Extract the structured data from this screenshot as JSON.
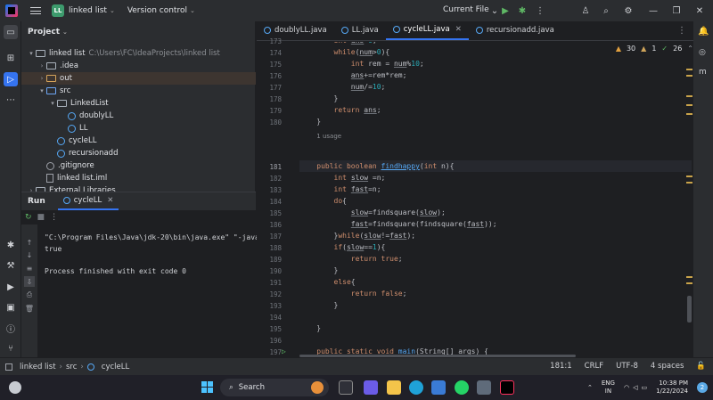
{
  "titlebar": {
    "project_badge": "LL",
    "project_name": "linked list",
    "vcs_label": "Version control",
    "run_config": "Current File"
  },
  "project_panel": {
    "title": "Project",
    "tree": [
      {
        "label": "linked list",
        "path": "C:\\Users\\FC\\IdeaProjects\\linked list",
        "indent": 0,
        "arrow": "▾",
        "icon": "folder"
      },
      {
        "label": ".idea",
        "indent": 1,
        "arrow": "›",
        "icon": "folder"
      },
      {
        "label": "out",
        "indent": 1,
        "arrow": "›",
        "icon": "folder-orange"
      },
      {
        "label": "src",
        "indent": 1,
        "arrow": "▾",
        "icon": "folder-blue"
      },
      {
        "label": "LinkedList",
        "indent": 2,
        "arrow": "▾",
        "icon": "folder"
      },
      {
        "label": "doublyLL",
        "indent": 3,
        "arrow": "",
        "icon": "class"
      },
      {
        "label": "LL",
        "indent": 3,
        "arrow": "",
        "icon": "class"
      },
      {
        "label": "cycleLL",
        "indent": 2,
        "arrow": "",
        "icon": "class"
      },
      {
        "label": "recursionadd",
        "indent": 2,
        "arrow": "",
        "icon": "class"
      },
      {
        "label": ".gitignore",
        "indent": 1,
        "arrow": "",
        "icon": "git"
      },
      {
        "label": "linked list.iml",
        "indent": 1,
        "arrow": "",
        "icon": "file"
      },
      {
        "label": "External Libraries",
        "indent": 0,
        "arrow": "›",
        "icon": "folder"
      }
    ]
  },
  "run_panel": {
    "title": "Run",
    "tab_label": "cycleLL",
    "console_lines": [
      "\"C:\\Program Files\\Java\\jdk-20\\bin\\java.exe\" \"-javaa",
      "true",
      "",
      "Process finished with exit code 0"
    ]
  },
  "editor": {
    "tabs": [
      {
        "label": "doublyLL.java",
        "active": false
      },
      {
        "label": "LL.java",
        "active": false
      },
      {
        "label": "cycleLL.java",
        "active": true
      },
      {
        "label": "recursionadd.java",
        "active": false
      }
    ],
    "inspections": {
      "warnings": "30",
      "weak": "1",
      "ok": "26"
    },
    "line_numbers": [
      "173",
      "174",
      "175",
      "176",
      "177",
      "178",
      "179",
      "180",
      "181",
      "182",
      "183",
      "184",
      "185",
      "186",
      "187",
      "188",
      "189",
      "190",
      "191",
      "192",
      "193",
      "194",
      "195",
      "196",
      "197",
      "198",
      "199"
    ],
    "usage_hint": "1 usage",
    "current_line": "181"
  },
  "statusbar": {
    "breadcrumb": [
      "linked list",
      "src",
      "cycleLL"
    ],
    "position": "181:1",
    "line_sep": "CRLF",
    "encoding": "UTF-8",
    "indent": "4 spaces"
  },
  "taskbar": {
    "search_label": "Search",
    "lang_top": "ENG",
    "lang_bottom": "IN",
    "time": "10:38 PM",
    "date": "1/22/2024",
    "notif_count": "2"
  }
}
